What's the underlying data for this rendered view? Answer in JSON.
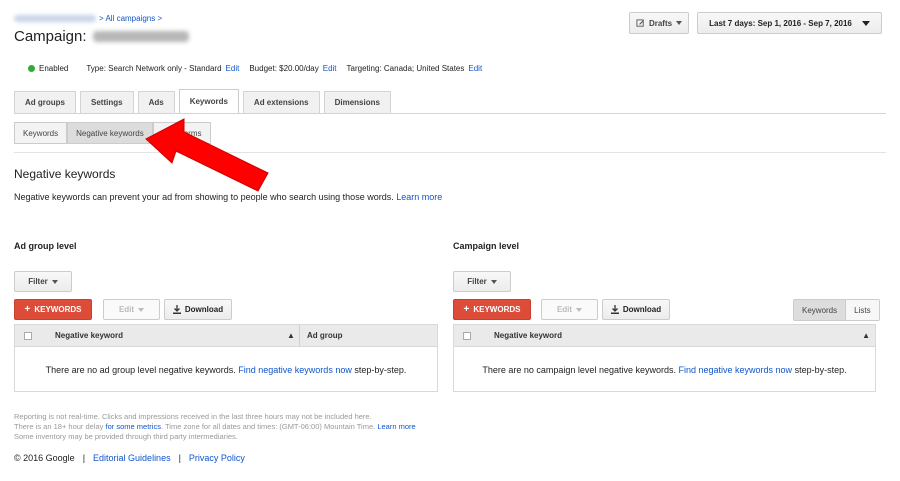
{
  "breadcrumb": {
    "all_campaigns": "> All campaigns >"
  },
  "campaign": {
    "label": "Campaign:"
  },
  "header": {
    "drafts_label": "Drafts",
    "date_range": "Last 7 days: Sep 1, 2016 - Sep 7, 2016"
  },
  "info": {
    "status": "Enabled",
    "type_text": "Type: Search Network only - Standard",
    "type_edit": "Edit",
    "budget_text": "Budget: $20.00/day",
    "budget_edit": "Edit",
    "targeting_text": "Targeting: Canada; United States",
    "targeting_edit": "Edit",
    "status_color": "#33aa33"
  },
  "tabs": [
    {
      "label": "Ad groups"
    },
    {
      "label": "Settings"
    },
    {
      "label": "Ads"
    },
    {
      "label": "Keywords"
    },
    {
      "label": "Ad extensions"
    },
    {
      "label": "Dimensions"
    }
  ],
  "subtabs": [
    {
      "label": "Keywords"
    },
    {
      "label": "Negative keywords"
    },
    {
      "label": "erms"
    }
  ],
  "page": {
    "title": "Negative keywords",
    "description": "Negative keywords can prevent your ad from showing to people who search using those words.",
    "learn_more": "Learn more"
  },
  "ad_group": {
    "title": "Ad group level",
    "filter": "Filter",
    "add_keywords": "KEYWORDS",
    "edit": "Edit",
    "download": "Download",
    "col_keyword": "Negative keyword",
    "col_adgroup": "Ad group",
    "empty_prefix": "There are no ad group level negative keywords.",
    "empty_link": "Find negative keywords now",
    "empty_suffix": "step-by-step."
  },
  "campaign_level": {
    "title": "Campaign level",
    "filter": "Filter",
    "add_keywords": "KEYWORDS",
    "edit": "Edit",
    "download": "Download",
    "toggle_keywords": "Keywords",
    "toggle_lists": "Lists",
    "col_keyword": "Negative keyword",
    "empty_prefix": "There are no campaign level negative keywords.",
    "empty_link": "Find negative keywords now",
    "empty_suffix": "step-by-step."
  },
  "notes": {
    "line1": "Reporting is not real-time. Clicks and impressions received in the last three hours may not be included here.",
    "line2_prefix": "There is an 18+ hour delay",
    "line2_link": "for some metrics",
    "line2_mid": ". Time zone for all dates and times: (GMT-06:00) Mountain Time.",
    "line2_learn": "Learn more",
    "line3": "Some inventory may be provided through third party intermediaries."
  },
  "footer": {
    "copyright": "© 2016 Google",
    "sep": "|",
    "guidelines": "Editorial Guidelines",
    "privacy": "Privacy Policy"
  },
  "colors": {
    "accent_red": "#dd4b39",
    "link_blue": "#1155cc",
    "arrow_red": "#ff0000"
  }
}
